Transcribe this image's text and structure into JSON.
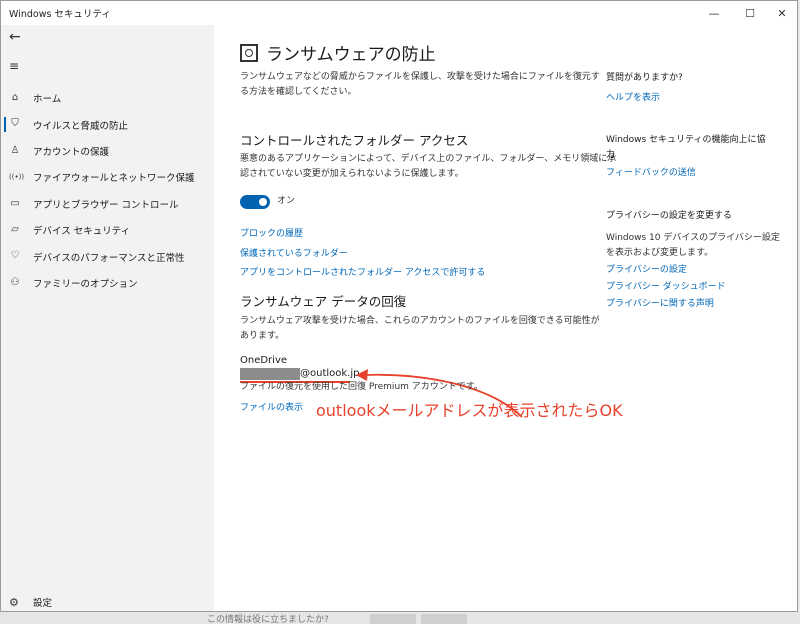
{
  "window": {
    "title": "Windows セキュリティ",
    "controls": {
      "minimize": "—",
      "maximize": "☐",
      "close": "✕"
    }
  },
  "sidebar": {
    "back_icon": "←",
    "menu_icon": "≡",
    "items": [
      {
        "label": "ホーム",
        "icon": "home-icon",
        "glyph": "⌂"
      },
      {
        "label": "ウイルスと脅威の防止",
        "icon": "shield-icon",
        "glyph": "⛉"
      },
      {
        "label": "アカウントの保護",
        "icon": "person-icon",
        "glyph": "♙"
      },
      {
        "label": "ファイアウォールとネットワーク保護",
        "icon": "wifi-icon",
        "glyph": "((•))"
      },
      {
        "label": "アプリとブラウザー コントロール",
        "icon": "app-window-icon",
        "glyph": "▭"
      },
      {
        "label": "デバイス セキュリティ",
        "icon": "laptop-icon",
        "glyph": "▱"
      },
      {
        "label": "デバイスのパフォーマンスと正常性",
        "icon": "heart-icon",
        "glyph": "♡"
      },
      {
        "label": "ファミリーのオプション",
        "icon": "family-icon",
        "glyph": "⚇"
      }
    ],
    "settings": {
      "label": "設定",
      "glyph": "⚙"
    }
  },
  "main": {
    "title": "ランサムウェアの防止",
    "intro": [
      "ランサムウェアなどの脅威からファイルを保護し、攻撃を受けた場合にファイルを復元す",
      "る方法を確認してください。"
    ],
    "cfa": {
      "heading": "コントロールされたフォルダー アクセス",
      "desc": [
        "悪意のあるアプリケーションによって、デバイス上のファイル、フォルダー、メモリ領域に承",
        "認されていない変更が加えられないように保護します。"
      ],
      "toggle_label": "オン",
      "toggle_on": true,
      "links": [
        "ブロックの履歴",
        "保護されているフォルダー",
        "アプリをコントロールされたフォルダー アクセスで許可する"
      ]
    },
    "recovery": {
      "heading": "ランサムウェア データの回復",
      "desc": [
        "ランサムウェア攻撃を受けた場合、これらのアカウントのファイルを回復できる可能性が",
        "あります。"
      ],
      "provider": "OneDrive",
      "email_suffix": "@outlook.jp",
      "note": "ファイルの復元を使用した回復 Premium アカウントです。",
      "view_link": "ファイルの表示"
    },
    "annotation": "outlookメールアドレスが表示されたらOK"
  },
  "right": {
    "q_heading": "質問がありますか?",
    "help_link": "ヘルプを表示",
    "improve_heading": [
      "Windows セキュリティの機能向上に協",
      "力"
    ],
    "feedback_link": "フィードバックの送信",
    "privacy_heading": "プライバシーの設定を変更する",
    "privacy_text": [
      "Windows 10 デバイスのプライバシー設定",
      "を表示および変更します。"
    ],
    "privacy_links": [
      "プライバシーの設定",
      "プライバシー ダッシュボード",
      "プライバシーに関する声明"
    ]
  },
  "background": {
    "partial_text": "この情報は役に立ちましたか?"
  },
  "colors": {
    "accent": "#0063b1",
    "link": "#0067b8",
    "annotation": "#e8412c"
  }
}
